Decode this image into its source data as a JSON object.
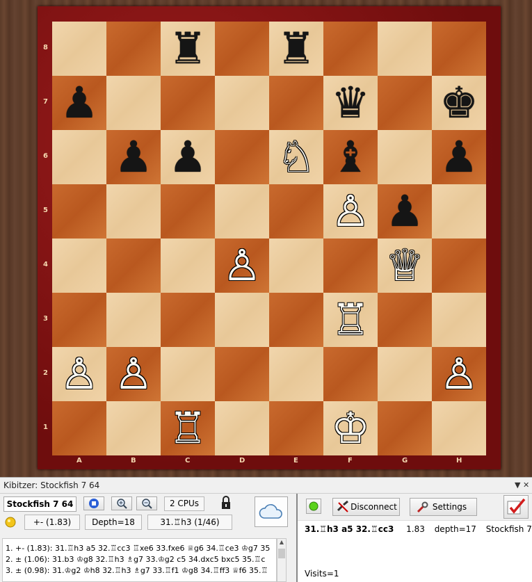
{
  "board": {
    "files": [
      "A",
      "B",
      "C",
      "D",
      "E",
      "F",
      "G",
      "H"
    ],
    "ranks": [
      "8",
      "7",
      "6",
      "5",
      "4",
      "3",
      "2",
      "1"
    ],
    "pieces": [
      {
        "sq": "c8",
        "glyph": "♜",
        "color": "b",
        "name": "black-rook-c8"
      },
      {
        "sq": "e8",
        "glyph": "♜",
        "color": "b",
        "name": "black-rook-e8"
      },
      {
        "sq": "a7",
        "glyph": "♟",
        "color": "b",
        "name": "black-pawn-a7"
      },
      {
        "sq": "f7",
        "glyph": "♛",
        "color": "b",
        "name": "black-queen-f7"
      },
      {
        "sq": "h7",
        "glyph": "♚",
        "color": "b",
        "name": "black-king-h7"
      },
      {
        "sq": "b6",
        "glyph": "♟",
        "color": "b",
        "name": "black-pawn-b6"
      },
      {
        "sq": "c6",
        "glyph": "♟",
        "color": "b",
        "name": "black-pawn-c6"
      },
      {
        "sq": "e6",
        "glyph": "♘",
        "color": "w",
        "name": "white-knight-e6"
      },
      {
        "sq": "f6",
        "glyph": "♝",
        "color": "b",
        "name": "black-bishop-f6"
      },
      {
        "sq": "h6",
        "glyph": "♟",
        "color": "b",
        "name": "black-pawn-h6"
      },
      {
        "sq": "f5",
        "glyph": "♙",
        "color": "w",
        "name": "white-pawn-f5"
      },
      {
        "sq": "g5",
        "glyph": "♟",
        "color": "b",
        "name": "black-pawn-g5"
      },
      {
        "sq": "d4",
        "glyph": "♙",
        "color": "w",
        "name": "white-pawn-d4"
      },
      {
        "sq": "g4",
        "glyph": "♕",
        "color": "w",
        "name": "white-queen-g4"
      },
      {
        "sq": "f3",
        "glyph": "♖",
        "color": "w",
        "name": "white-rook-f3"
      },
      {
        "sq": "a2",
        "glyph": "♙",
        "color": "w",
        "name": "white-pawn-a2"
      },
      {
        "sq": "b2",
        "glyph": "♙",
        "color": "w",
        "name": "white-pawn-b2"
      },
      {
        "sq": "h2",
        "glyph": "♙",
        "color": "w",
        "name": "white-pawn-h2"
      },
      {
        "sq": "c1",
        "glyph": "♖",
        "color": "w",
        "name": "white-rook-c1"
      },
      {
        "sq": "f1",
        "glyph": "♔",
        "color": "w",
        "name": "white-king-f1"
      }
    ]
  },
  "kibitzer": {
    "title": "Kibitzer: Stockfish 7 64",
    "engine_name": "Stockfish 7 64",
    "cpus": "2 CPUs",
    "evaluation": "+- (1.83)",
    "depth": "Depth=18",
    "current_move": "31.♖h3 (1/46)",
    "disconnect_label": "Disconnect",
    "settings_label": "Settings",
    "lines": [
      "1. +- (1.83): 31.♖h3 a5 32.♖cc3 ♖xe6 33.fxe6 ♕g6 34.♖ce3 ♔g7 35",
      "2. ± (1.06): 31.b3 ♔g8 32.♖h3 ♗g7 33.♔g2 c5 34.dxc5 bxc5 35.♖c",
      "3. ± (0.98): 31.♔g2 ♔h8 32.♖h3 ♗g7 33.♖f1 ♔g8 34.♖ff3 ♕f6 35.♖"
    ],
    "best_line": "31.♖h3 a5 32.♖cc3",
    "best_eval": "1.83",
    "best_depth": "depth=17",
    "best_engine": "Stockfish 7",
    "visits": "Visits=1"
  }
}
